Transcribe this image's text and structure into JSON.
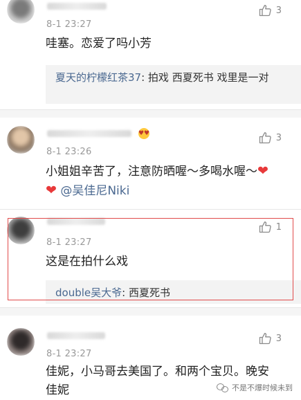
{
  "comments": [
    {
      "time": "8-1 23:27",
      "likes": "3",
      "text": "哇塞。恋爱了吗小芳",
      "reply": {
        "name": "夏天的柠檬红茶37",
        "sep": ": ",
        "text": "拍戏  西夏死书  戏里是一对"
      }
    },
    {
      "time": "8-1 23:26",
      "likes": "3",
      "text": "小姐姐辛苦了，注意防晒喔～多喝水喔～",
      "heart": "❤",
      "mention": "@吴佳尼Niki"
    },
    {
      "time": "8-1 23:27",
      "likes": "1",
      "text": "这是在拍什么戏",
      "reply": {
        "name": "double吴大爷",
        "sep": ": ",
        "text": "西夏死书"
      },
      "highlighted": true
    },
    {
      "time": "8-1 23:27",
      "likes": "3",
      "text_line1": "佳妮，小马哥去美国了。和两个宝贝。晚安",
      "text_line2": "佳妮"
    }
  ],
  "watermark": {
    "text": "不是不爆时候未到"
  },
  "colors": {
    "link": "#4a6890",
    "heart": "#e8393a",
    "highlight_border": "#e14a4a"
  },
  "icons": {
    "like": "thumbs-up-icon",
    "heart": "heart-icon",
    "watermark": "wechat-logo-icon"
  }
}
